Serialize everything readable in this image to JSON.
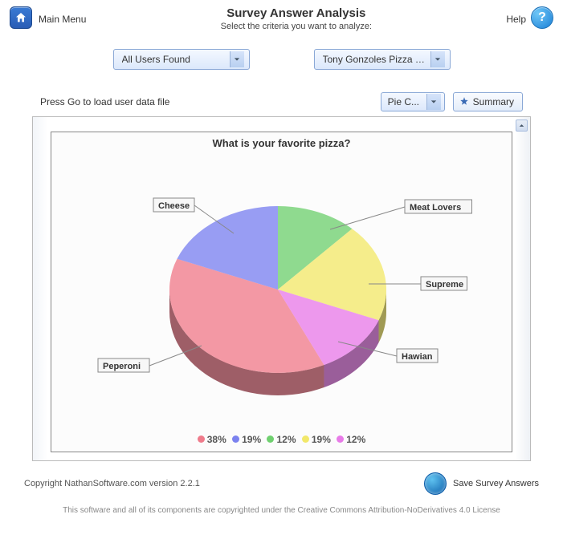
{
  "header": {
    "main_menu": "Main Menu",
    "title": "Survey Answer Analysis",
    "subtitle": "Select the criteria you want to analyze:",
    "help": "Help"
  },
  "selectors": {
    "users": "All Users Found",
    "survey": "Tony Gonzoles Pizza S..."
  },
  "toolbar": {
    "hint": "Press Go to load user data file",
    "chart_type": "Pie C...",
    "summary": "Summary"
  },
  "chart_data": {
    "type": "pie",
    "title": "What is your favorite pizza?",
    "series": [
      {
        "name": "Peperoni",
        "value": 38,
        "label": "38%",
        "color": "#ef7b8b"
      },
      {
        "name": "Cheese",
        "value": 19,
        "label": "19%",
        "color": "#7b82ef"
      },
      {
        "name": "Meat Lovers",
        "value": 12,
        "label": "12%",
        "color": "#6fd06f"
      },
      {
        "name": "Supreme",
        "value": 19,
        "label": "19%",
        "color": "#f2e86a"
      },
      {
        "name": "Hawian",
        "value": 12,
        "label": "12%",
        "color": "#e87be8"
      }
    ]
  },
  "footer": {
    "copyright": "Copyright NathanSoftware.com version 2.2.1",
    "save": "Save Survey Answers",
    "license": "This software and all of its components are copyrighted under the Creative Commons Attribution-NoDerivatives 4.0 License"
  }
}
